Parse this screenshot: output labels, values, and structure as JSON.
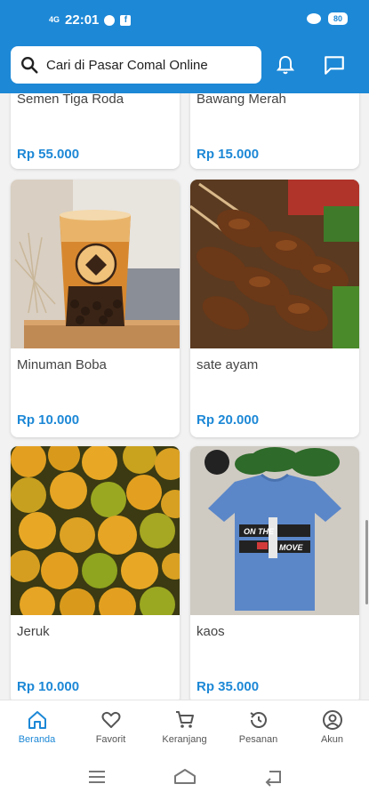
{
  "status_bar": {
    "signal": "4G",
    "time": "22:01",
    "fb": "f",
    "battery": "80"
  },
  "search": {
    "placeholder": "Cari di Pasar Comal Online"
  },
  "products": [
    {
      "name": "Semen Tiga Roda",
      "price": "Rp 55.000"
    },
    {
      "name": "Bawang Merah",
      "price": "Rp 15.000"
    },
    {
      "name": "Minuman Boba",
      "price": "Rp 10.000"
    },
    {
      "name": "sate ayam",
      "price": "Rp 20.000"
    },
    {
      "name": "Jeruk",
      "price": "Rp 10.000"
    },
    {
      "name": "kaos",
      "price": "Rp 35.000"
    }
  ],
  "shirt_print": {
    "line1": "ON THE",
    "line2": "MOVE"
  },
  "bottom_nav": [
    {
      "label": "Beranda",
      "icon": "home-icon",
      "active": true
    },
    {
      "label": "Favorit",
      "icon": "heart-icon"
    },
    {
      "label": "Keranjang",
      "icon": "cart-icon"
    },
    {
      "label": "Pesanan",
      "icon": "history-icon"
    },
    {
      "label": "Akun",
      "icon": "account-icon"
    }
  ],
  "colors": {
    "primary": "#1d88d6",
    "price": "#1d88d6"
  }
}
